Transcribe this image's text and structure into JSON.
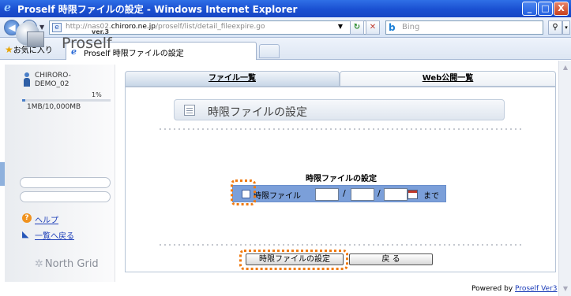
{
  "window": {
    "title": "Proself 時限ファイルの設定 - Windows Internet Explorer",
    "min_label": "_",
    "max_label": "□",
    "close_label": "X"
  },
  "browser": {
    "back_label": "◀",
    "forward_label": "▶",
    "url_prefix": "http://nas02.",
    "url_host": "chiroro.ne.jp",
    "url_path": "/proself/list/detail_fileexpire.go",
    "search_placeholder": "Bing",
    "favorites_label": "お気に入り",
    "tab_title": "Proself 時限ファイルの設定"
  },
  "sidebar": {
    "version": "ver.3",
    "product": "Proself",
    "user_name": "CHIRORO-\nDEMO_02",
    "quota_percent": "1%",
    "quota_fraction": 0.01,
    "quota_text": "1MB/10,000MB",
    "help_label": "ヘルプ",
    "back_to_list_label": "一覧へ戻る",
    "vendor": "North Grid"
  },
  "tabs": [
    {
      "label": "ファイル一覧",
      "active": true
    },
    {
      "label": "Web公開一覧",
      "active": false
    }
  ],
  "main": {
    "heading": "時限ファイルの設定",
    "section_title": "時限ファイルの設定",
    "checkbox_label": "時限ファイル",
    "date_separator": "/",
    "until_label": "まで",
    "submit_label": "時限ファイルの設定",
    "back_label": "戻 る"
  },
  "footer": {
    "powered_prefix": "Powered by",
    "powered_link": "Proself Ver3"
  },
  "colors": {
    "highlight": "#f07a10",
    "row_background": "#7b9fd9",
    "title_bar": "#1a4fd1"
  },
  "icons": {
    "ie": "e-icon",
    "doc": "document-icon",
    "calendar": "calendar-icon",
    "help": "help-icon",
    "user": "user-icon"
  }
}
